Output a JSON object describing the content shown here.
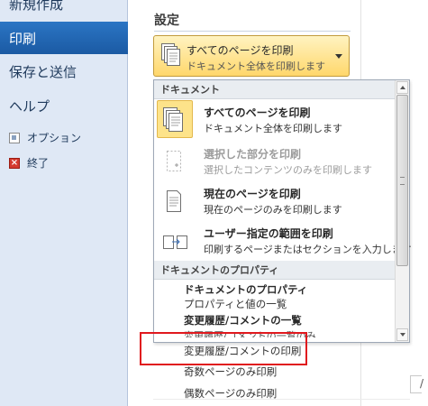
{
  "nav": {
    "new": "新規作成",
    "print": "印刷",
    "save_send": "保存と送信",
    "help": "ヘルプ",
    "option": "オプション",
    "exit": "終了"
  },
  "settings": {
    "heading": "設定",
    "dropdown": {
      "title": "すべてのページを印刷",
      "subtitle": "ドキュメント全体を印刷します"
    }
  },
  "list": {
    "section_document": "ドキュメント",
    "options": [
      {
        "title": "すべてのページを印刷",
        "subtitle": "ドキュメント全体を印刷します",
        "icon": "pages-stack-icon",
        "selected": true,
        "disabled": false
      },
      {
        "title": "選択した部分を印刷",
        "subtitle": "選択したコンテンツのみを印刷します",
        "icon": "selection-page-icon",
        "selected": false,
        "disabled": true
      },
      {
        "title": "現在のページを印刷",
        "subtitle": "現在のページのみを印刷します",
        "icon": "single-page-icon",
        "selected": false,
        "disabled": false
      },
      {
        "title": "ユーザー指定の範囲を印刷",
        "subtitle": "印刷するページまたはセクションを入力します",
        "icon": "page-range-icon",
        "selected": false,
        "disabled": false
      }
    ],
    "section_properties": "ドキュメントのプロパティ",
    "property_items": [
      {
        "label": "ドキュメントのプロパティ",
        "bold": true
      },
      {
        "label": "プロパティと値の一覧",
        "bold": false
      },
      {
        "label": "変更履歴/コメントの一覧",
        "bold": true
      },
      {
        "label": "変更履歴/コメントの一覧のみ",
        "bold": false
      }
    ]
  },
  "below_items": [
    "変更履歴/コメントの印刷",
    "奇数ページのみ印刷",
    "偶数ページのみ印刷"
  ],
  "edge_text": "/",
  "colors": {
    "nav_bg": "#dfe8f5",
    "nav_selected": "#1b5aa3",
    "dropdown_bg": "#ffd76b",
    "highlight": "#fde38a",
    "annotation_red": "#e0191e"
  }
}
